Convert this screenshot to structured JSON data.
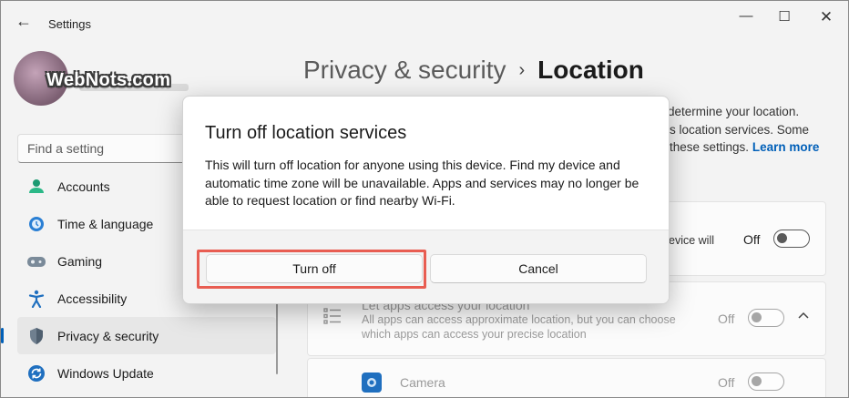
{
  "window": {
    "title": "Settings",
    "back_icon": "←",
    "minimize_icon": "—",
    "maximize_icon": "☐",
    "close_icon": "✕"
  },
  "watermark": "WebNots.com",
  "sidebar": {
    "search_placeholder": "Find a setting",
    "items": [
      {
        "label": "Accounts",
        "icon": "accounts-icon"
      },
      {
        "label": "Time & language",
        "icon": "time-language-icon"
      },
      {
        "label": "Gaming",
        "icon": "gaming-icon"
      },
      {
        "label": "Accessibility",
        "icon": "accessibility-icon"
      },
      {
        "label": "Privacy & security",
        "icon": "shield-icon",
        "active": true
      },
      {
        "label": "Windows Update",
        "icon": "update-icon"
      }
    ]
  },
  "main": {
    "breadcrumb_parent": "Privacy & security",
    "breadcrumb_separator": "›",
    "breadcrumb_current": "Location",
    "description_line1": "determine your location.",
    "description_line2": "s location services. Some",
    "description_line3": "these settings.",
    "learn_more": "Learn more",
    "location_card": {
      "partial_text": "evice will",
      "toggle_label": "Off"
    },
    "apps_card": {
      "title": "Let apps access your location",
      "subtitle": "All apps can access approximate location, but you can choose which apps can access your precise location",
      "toggle_label": "Off"
    },
    "camera_card": {
      "label": "Camera",
      "toggle_label": "Off"
    }
  },
  "dialog": {
    "title": "Turn off location services",
    "body": "This will turn off location for anyone using this device. Find my device and automatic time zone will be unavailable. Apps and services may no longer be able to request location or find nearby Wi-Fi.",
    "primary_button": "Turn off",
    "secondary_button": "Cancel"
  },
  "colors": {
    "accent": "#005fb8",
    "highlight": "#e85d52"
  }
}
